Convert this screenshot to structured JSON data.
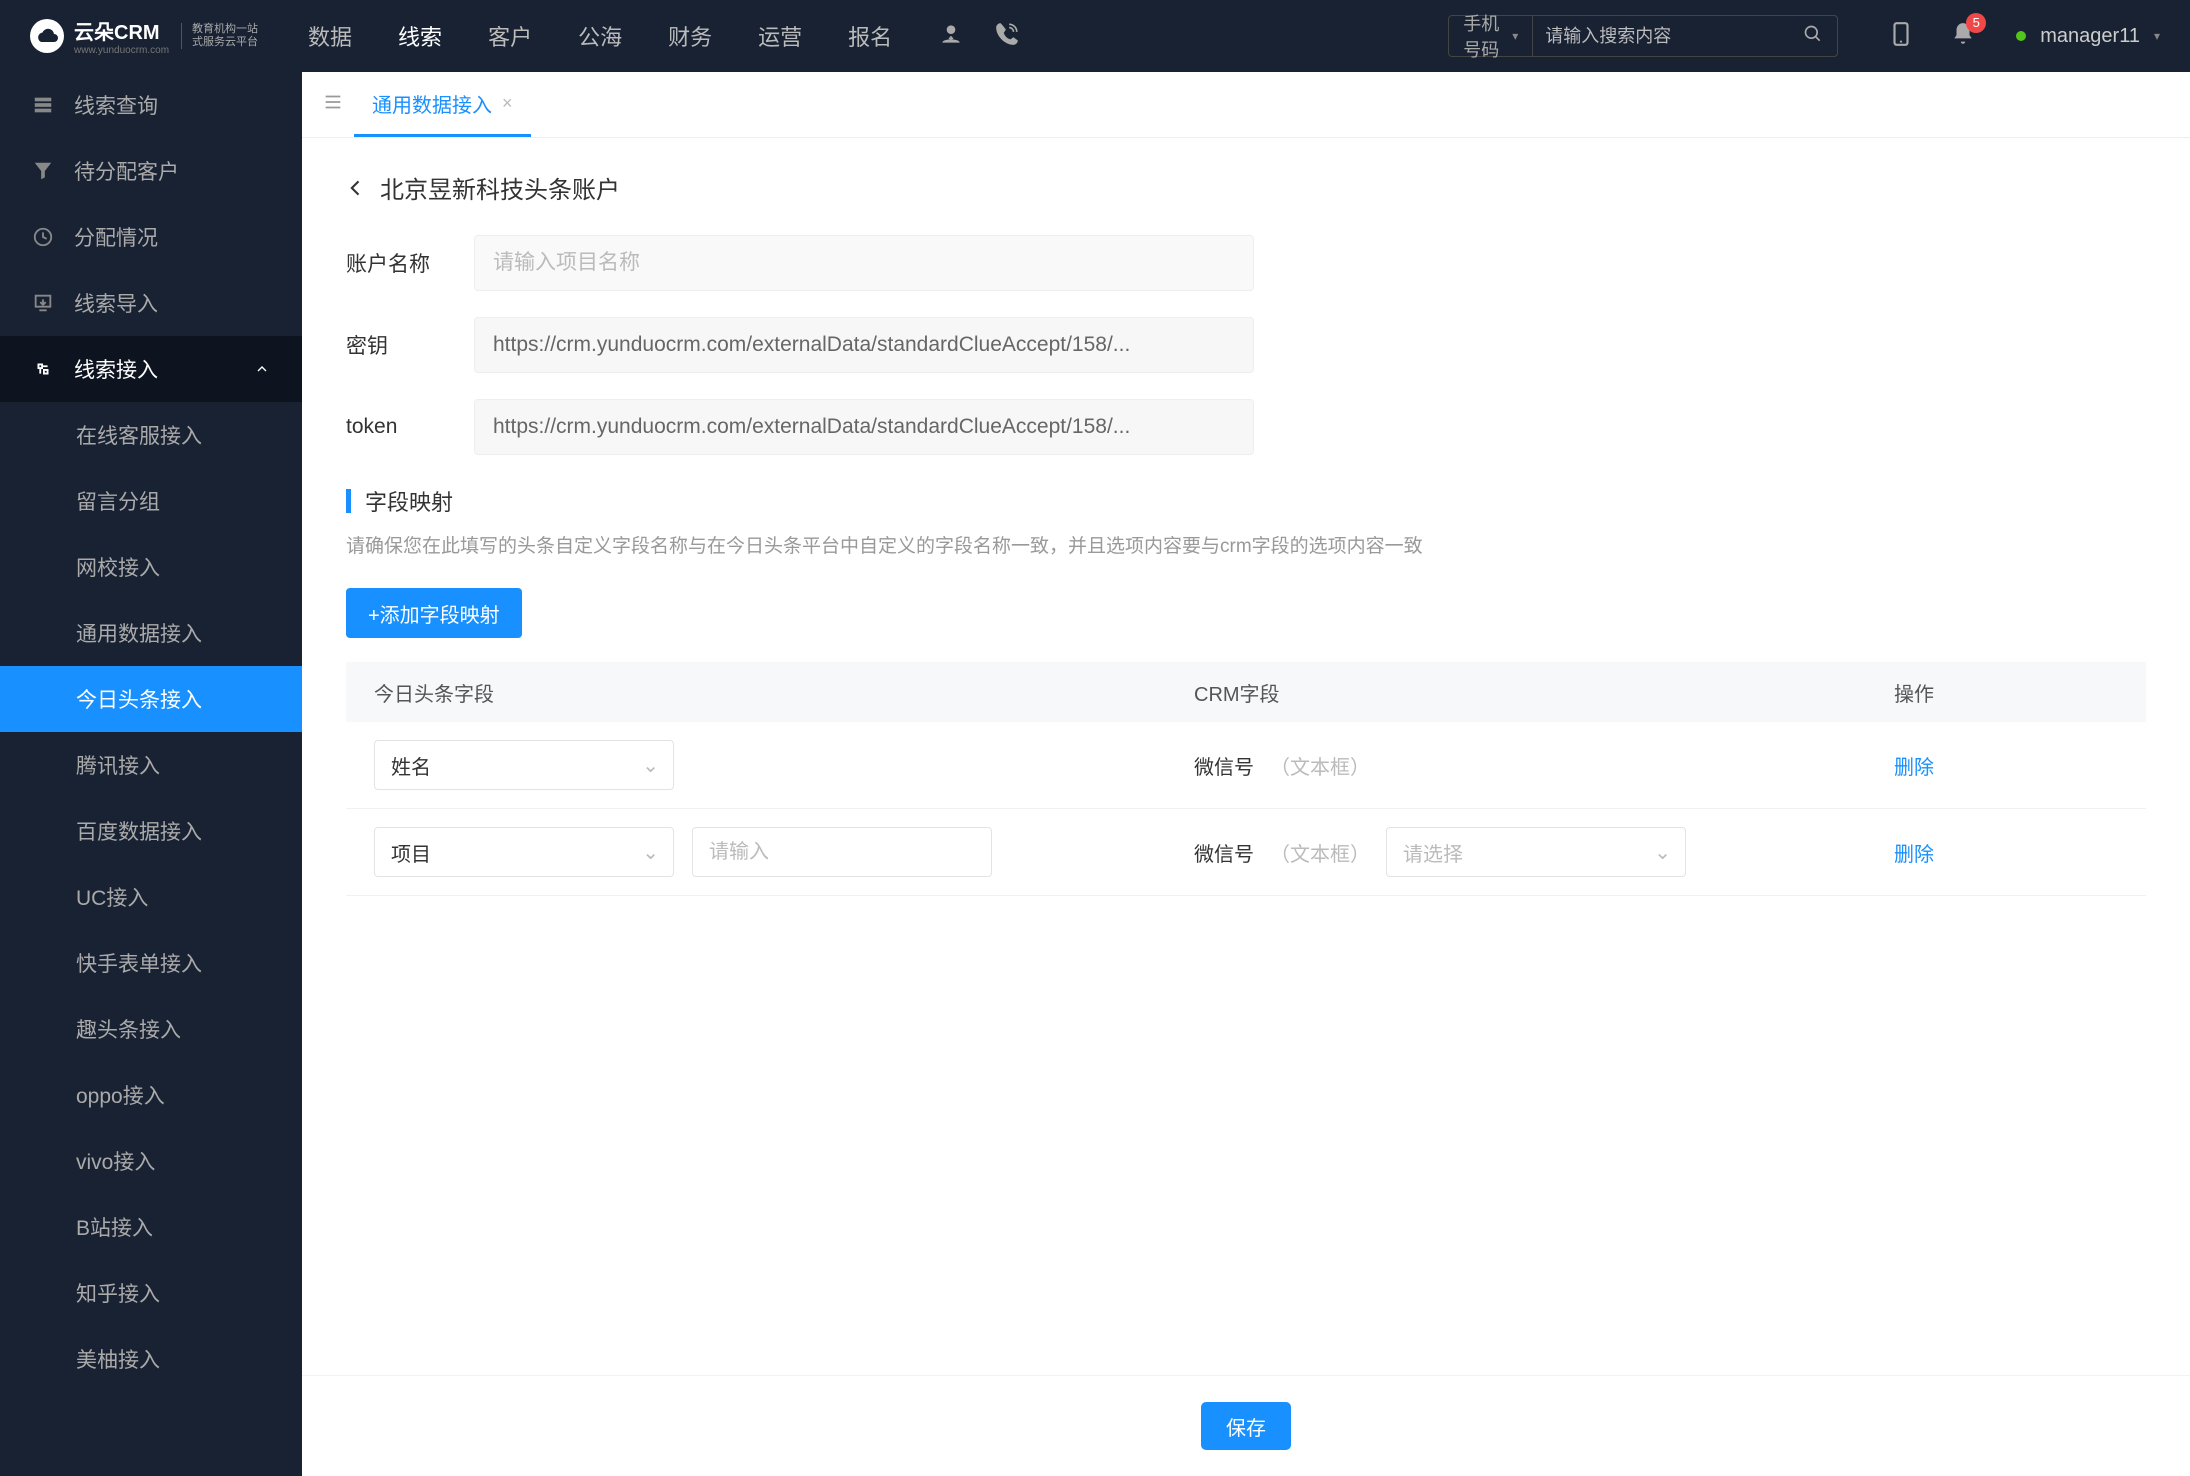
{
  "brand": {
    "name": "云朵CRM",
    "sub1": "教育机构一站",
    "sub2": "式服务云平台",
    "domain": "www.yunduocrm.com"
  },
  "topnav": [
    "数据",
    "线索",
    "客户",
    "公海",
    "财务",
    "运营",
    "报名"
  ],
  "topnav_active": 1,
  "search": {
    "selector": "手机号码",
    "placeholder": "请输入搜索内容"
  },
  "notif_count": "5",
  "username": "manager11",
  "sidebar": {
    "items": [
      {
        "label": "线索查询",
        "icon": "list"
      },
      {
        "label": "待分配客户",
        "icon": "funnel"
      },
      {
        "label": "分配情况",
        "icon": "clock"
      },
      {
        "label": "线索导入",
        "icon": "upload"
      },
      {
        "label": "线索接入",
        "icon": "plug",
        "expanded": true,
        "children": [
          "在线客服接入",
          "留言分组",
          "网校接入",
          "通用数据接入",
          "今日头条接入",
          "腾讯接入",
          "百度数据接入",
          "UC接入",
          "快手表单接入",
          "趣头条接入",
          "oppo接入",
          "vivo接入",
          "B站接入",
          "知乎接入",
          "美柚接入"
        ],
        "active_child": 4
      }
    ]
  },
  "tab": {
    "label": "通用数据接入"
  },
  "page": {
    "title": "北京昱新科技头条账户",
    "form": {
      "name_label": "账户名称",
      "name_placeholder": "请输入项目名称",
      "secret_label": "密钥",
      "secret_value": "https://crm.yunduocrm.com/externalData/standardClueAccept/158/...",
      "token_label": "token",
      "token_value": "https://crm.yunduocrm.com/externalData/standardClueAccept/158/..."
    },
    "section": {
      "title": "字段映射",
      "hint": "请确保您在此填写的头条自定义字段名称与在今日头条平台中自定义的字段名称一致，并且选项内容要与crm字段的选项内容一致"
    },
    "add_button": "+添加字段映射",
    "table": {
      "headers": [
        "今日头条字段",
        "CRM字段",
        "操作"
      ],
      "rows": [
        {
          "tt_select": "姓名",
          "tt_input": null,
          "crm_field": "微信号",
          "crm_type": "（文本框）",
          "crm_select": null,
          "action": "删除"
        },
        {
          "tt_select": "项目",
          "tt_input_placeholder": "请输入",
          "crm_field": "微信号",
          "crm_type": "（文本框）",
          "crm_select_placeholder": "请选择",
          "action": "删除"
        }
      ]
    },
    "save": "保存"
  }
}
